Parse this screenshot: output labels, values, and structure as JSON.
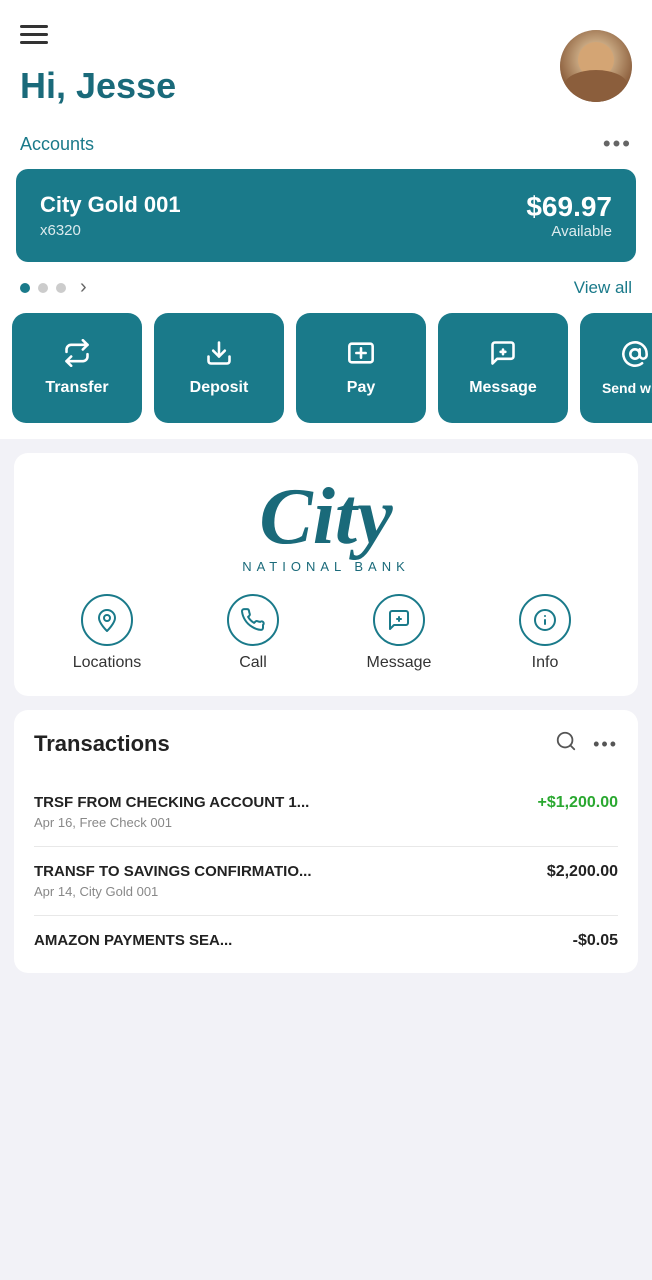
{
  "header": {
    "greeting": "Hi, Jesse"
  },
  "accounts": {
    "label": "Accounts",
    "more_label": "•••",
    "card": {
      "name": "City Gold 001",
      "number": "x6320",
      "balance": "$69.97",
      "available_label": "Available"
    },
    "pagination": {
      "dots": [
        true,
        false,
        false
      ],
      "view_all": "View all"
    }
  },
  "actions": [
    {
      "id": "transfer",
      "label": "Transfer"
    },
    {
      "id": "deposit",
      "label": "Deposit"
    },
    {
      "id": "pay",
      "label": "Pay"
    },
    {
      "id": "message",
      "label": "Message"
    },
    {
      "id": "send",
      "label": "Send with"
    }
  ],
  "bank": {
    "logo_big": "City",
    "logo_sub": "NATIONAL BANK",
    "actions": [
      {
        "id": "locations",
        "label": "Locations"
      },
      {
        "id": "call",
        "label": "Call"
      },
      {
        "id": "message",
        "label": "Message"
      },
      {
        "id": "info",
        "label": "Info"
      }
    ]
  },
  "transactions": {
    "title": "Transactions",
    "items": [
      {
        "name": "TRSF FROM CHECKING ACCOUNT 1...",
        "date": "Apr 16, Free Check 001",
        "amount": "+$1,200.00",
        "positive": true
      },
      {
        "name": "TRANSF TO SAVINGS CONFIRMATIO...",
        "date": "Apr 14, City Gold 001",
        "amount": "$2,200.00",
        "positive": false
      },
      {
        "name": "AMAZON PAYMENTS SEA...",
        "date": "",
        "amount": "-$0.05",
        "positive": false
      }
    ]
  }
}
